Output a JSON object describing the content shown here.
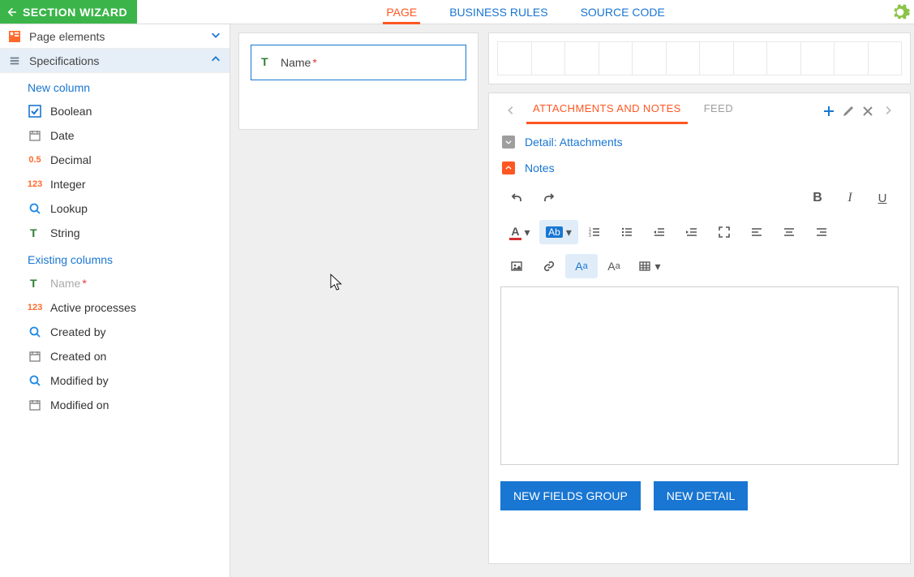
{
  "header": {
    "wizard_label": "SECTION WIZARD",
    "tabs": [
      "PAGE",
      "BUSINESS RULES",
      "SOURCE CODE"
    ],
    "active_tab_index": 0
  },
  "sidebar": {
    "sections": {
      "elements_label": "Page elements",
      "specs_label": "Specifications"
    },
    "new_column": {
      "title": "New column",
      "items": [
        {
          "id": "boolean",
          "label": "Boolean",
          "icon": "checkbox"
        },
        {
          "id": "date",
          "label": "Date",
          "icon": "calendar"
        },
        {
          "id": "decimal",
          "label": "Decimal",
          "icon": "decimal"
        },
        {
          "id": "integer",
          "label": "Integer",
          "icon": "integer"
        },
        {
          "id": "lookup",
          "label": "Lookup",
          "icon": "lookup"
        },
        {
          "id": "string",
          "label": "String",
          "icon": "string"
        }
      ]
    },
    "existing": {
      "title": "Existing columns",
      "items": [
        {
          "id": "name",
          "label": "Name",
          "icon": "string",
          "required": true,
          "disabled": true
        },
        {
          "id": "active_processes",
          "label": "Active processes",
          "icon": "integer"
        },
        {
          "id": "created_by",
          "label": "Created by",
          "icon": "lookup"
        },
        {
          "id": "created_on",
          "label": "Created on",
          "icon": "calendar"
        },
        {
          "id": "modified_by",
          "label": "Modified by",
          "icon": "lookup"
        },
        {
          "id": "modified_on",
          "label": "Modified on",
          "icon": "calendar"
        }
      ]
    }
  },
  "canvas": {
    "name_field_label": "Name"
  },
  "right": {
    "tabs": [
      "ATTACHMENTS AND NOTES",
      "FEED"
    ],
    "active_tab_index": 0,
    "attachments_label": "Detail: Attachments",
    "notes_label": "Notes"
  },
  "buttons": {
    "new_fields_group": "NEW FIELDS GROUP",
    "new_detail": "NEW DETAIL"
  }
}
